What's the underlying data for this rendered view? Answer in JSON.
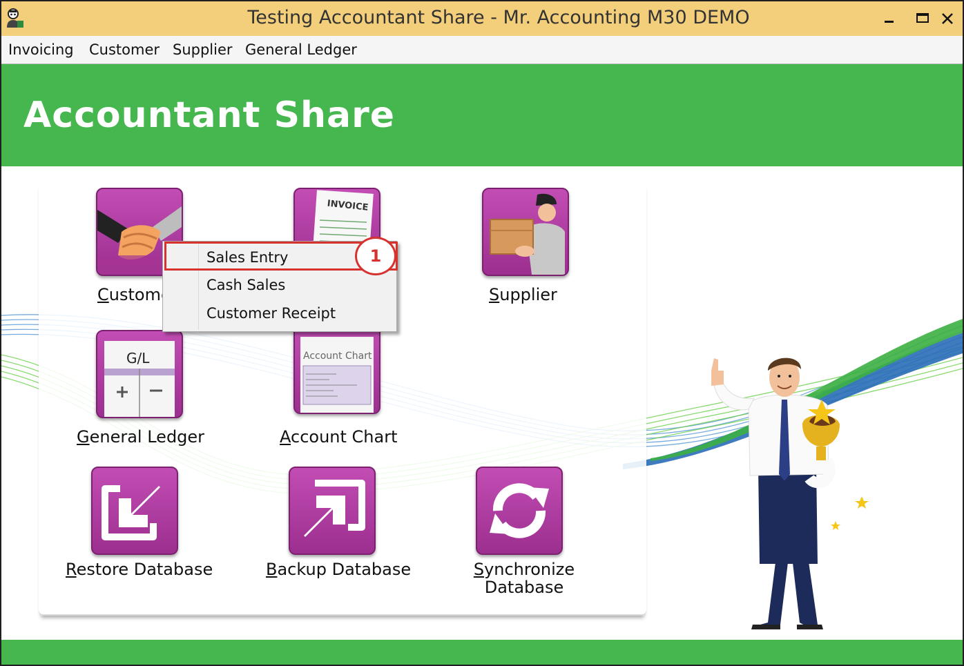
{
  "window": {
    "title": "Testing Accountant Share - Mr. Accounting M30 DEMO",
    "icon": "app-logo-icon"
  },
  "menu": {
    "items": [
      {
        "label": "Invoicing"
      },
      {
        "label": "Customer"
      },
      {
        "label": "Supplier"
      },
      {
        "label": "General Ledger"
      }
    ]
  },
  "banner": {
    "title": "Accountant Share"
  },
  "tiles": {
    "customer": {
      "label_u": "C",
      "label_rest": "ustome",
      "icon": "handshake-icon"
    },
    "invoice": {
      "icon": "invoice-icon",
      "icon_text": "INVOICE"
    },
    "supplier": {
      "label_u": "S",
      "label_rest": "upplier",
      "icon": "delivery-man-icon"
    },
    "general_ledger": {
      "label_u": "G",
      "label_rest": "eneral Ledger",
      "icon": "gl-ledger-icon",
      "icon_text": "G/L"
    },
    "account_chart": {
      "label_u": "A",
      "label_rest": "ccount Chart",
      "icon": "account-chart-icon",
      "icon_text": "Account Chart"
    },
    "restore": {
      "label_u": "R",
      "label_rest": "estore Database",
      "icon": "arrow-down-left-icon"
    },
    "backup": {
      "label_u": "B",
      "label_rest": "ackup Database",
      "icon": "arrow-up-right-icon"
    },
    "synchronize": {
      "label_line1_u": "S",
      "label_line1_rest": "ynchronize",
      "label_line2": "Database",
      "icon": "sync-arrows-icon"
    }
  },
  "context_menu": {
    "items": [
      {
        "label": "Sales Entry"
      },
      {
        "label": "Cash Sales"
      },
      {
        "label": "Customer Receipt"
      }
    ]
  },
  "annotation": {
    "number": "1",
    "color": "#d7332e"
  },
  "colors": {
    "title_bar": "#f3cf7c",
    "banner": "#46b74f",
    "tile": "#b23fa4",
    "highlight": "#d7332e"
  }
}
